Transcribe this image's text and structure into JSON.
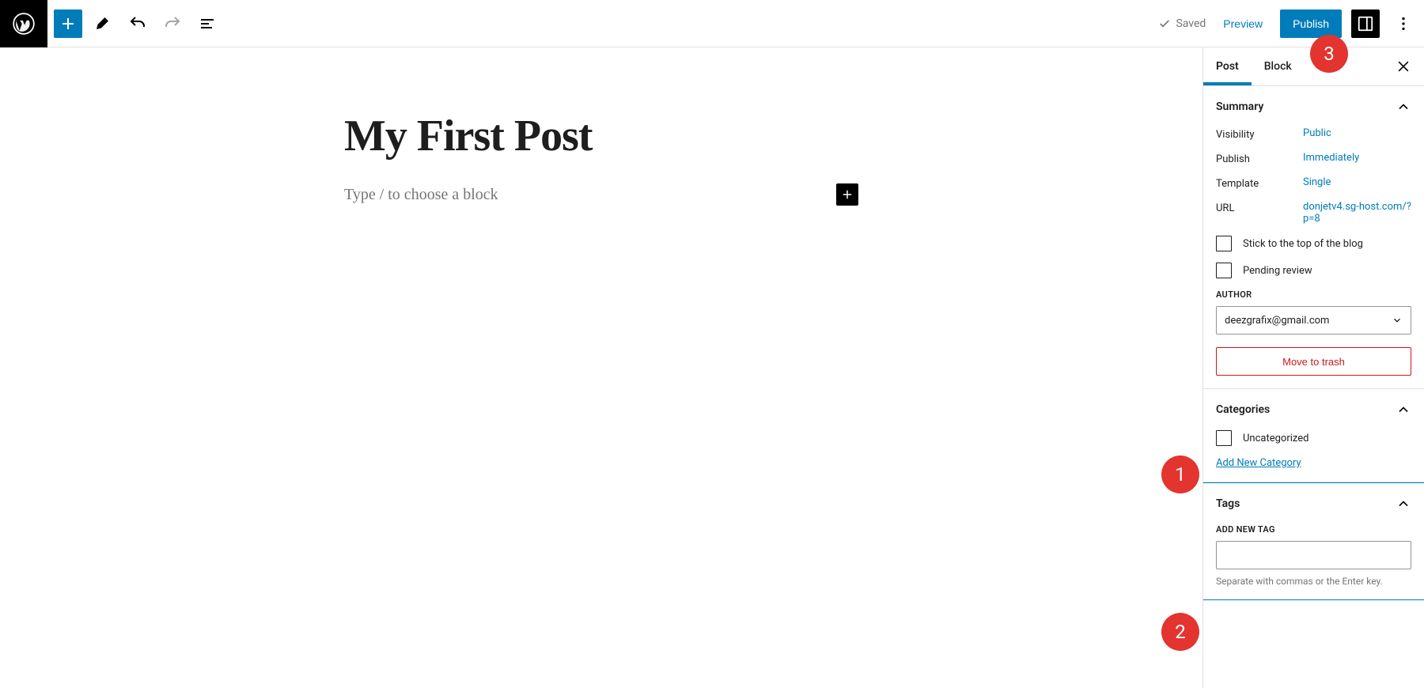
{
  "header": {
    "saved_label": "Saved",
    "preview_label": "Preview",
    "publish_label": "Publish"
  },
  "editor": {
    "title": "My First Post",
    "block_placeholder": "Type / to choose a block"
  },
  "sidebar": {
    "tabs": {
      "post": "Post",
      "block": "Block"
    },
    "summary": {
      "title": "Summary",
      "visibility_label": "Visibility",
      "visibility_value": "Public",
      "publish_label": "Publish",
      "publish_value": "Immediately",
      "template_label": "Template",
      "template_value": "Single",
      "url_label": "URL",
      "url_value": "donjetv4.sg-host.com/?p=8",
      "stick_label": "Stick to the top of the blog",
      "pending_label": "Pending review",
      "author_label": "AUTHOR",
      "author_value": "deezgrafix@gmail.com",
      "trash_label": "Move to trash"
    },
    "categories": {
      "title": "Categories",
      "uncategorized": "Uncategorized",
      "add_new": "Add New Category"
    },
    "tags": {
      "title": "Tags",
      "add_label": "ADD NEW TAG",
      "hint": "Separate with commas or the Enter key."
    }
  },
  "badges": {
    "b1": "1",
    "b2": "2",
    "b3": "3"
  }
}
